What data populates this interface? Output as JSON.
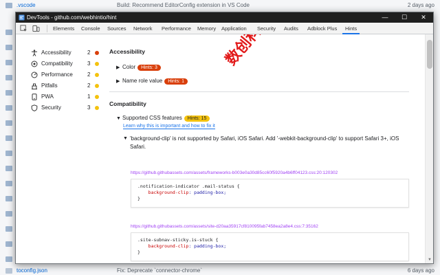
{
  "background": {
    "rows": [
      {
        "name": ".vscode",
        "message": "Build: Recommend EditorConfig extension in VS Code",
        "age": "2 days ago"
      },
      {
        "name": "toconfig.json",
        "message": "Fix: Deprecate `connector-chrome`",
        "age": "6 days ago"
      }
    ]
  },
  "window": {
    "title": "DevTools - github.com/webhintio/hint",
    "minimize": "—",
    "maximize": "☐",
    "close": "✕"
  },
  "tabs": [
    {
      "label": "Elements",
      "active": false
    },
    {
      "label": "Console",
      "active": false
    },
    {
      "label": "Sources",
      "active": false
    },
    {
      "label": "Network",
      "active": false
    },
    {
      "label": "Performance",
      "active": false
    },
    {
      "label": "Memory",
      "active": false
    },
    {
      "label": "Application",
      "active": false
    },
    {
      "label": "Security",
      "active": false
    },
    {
      "label": "Audits",
      "active": false
    },
    {
      "label": "Adblock Plus",
      "active": false
    },
    {
      "label": "Hints",
      "active": true
    }
  ],
  "sidebar": {
    "items": [
      {
        "label": "Accessibility",
        "count": "2",
        "icon": "accessibility-icon",
        "dot_color": "#d93f0b"
      },
      {
        "label": "Compatibility",
        "count": "3",
        "icon": "compatibility-icon",
        "dot_color": "#f4c20d"
      },
      {
        "label": "Performance",
        "count": "2",
        "icon": "performance-icon",
        "dot_color": "#f4c20d"
      },
      {
        "label": "Pitfalls",
        "count": "2",
        "icon": "pitfalls-icon",
        "dot_color": "#f4c20d"
      },
      {
        "label": "PWA",
        "count": "1",
        "icon": "pwa-icon",
        "dot_color": "#f4c20d"
      },
      {
        "label": "Security",
        "count": "3",
        "icon": "security-icon",
        "dot_color": "#f4c20d"
      }
    ]
  },
  "accessibility": {
    "title": "Accessibility",
    "categories": [
      {
        "label": "Color",
        "hints": "Hints: 3"
      },
      {
        "label": "Name role value",
        "hints": "Hints: 1"
      }
    ]
  },
  "compatibility": {
    "title": "Compatibility",
    "category": {
      "label": "Supported CSS features",
      "hints": "Hints: 15"
    },
    "learn_link": "Learn why this is important and how to fix it",
    "issue": "'background-clip' is not supported by Safari, iOS Safari. Add '-webkit-background-clip' to support Safari 3+, iOS Safari.",
    "sources": [
      {
        "url": "https://github.githubassets.com/assets/frameworks-b003e0a30d85cc60f5920a4b6ff04123.css:20:120302",
        "code": [
          ".notification-indicator .mail-status {",
          "background-clip",
          ": padding-box;",
          "}"
        ]
      },
      {
        "url": "https://github.githubassets.com/assets/site-d20aa35917cf810095fab7458ea2a8e4.css:7:35162",
        "code": [
          ".site-subnav-sticky.is-stuck {",
          "background-clip",
          ": padding-box;",
          "}"
        ]
      }
    ]
  },
  "watermark": "数创科scs66",
  "colors": {
    "accent": "#1a73e8",
    "error": "#d93f0b",
    "warning": "#f4c20d"
  }
}
